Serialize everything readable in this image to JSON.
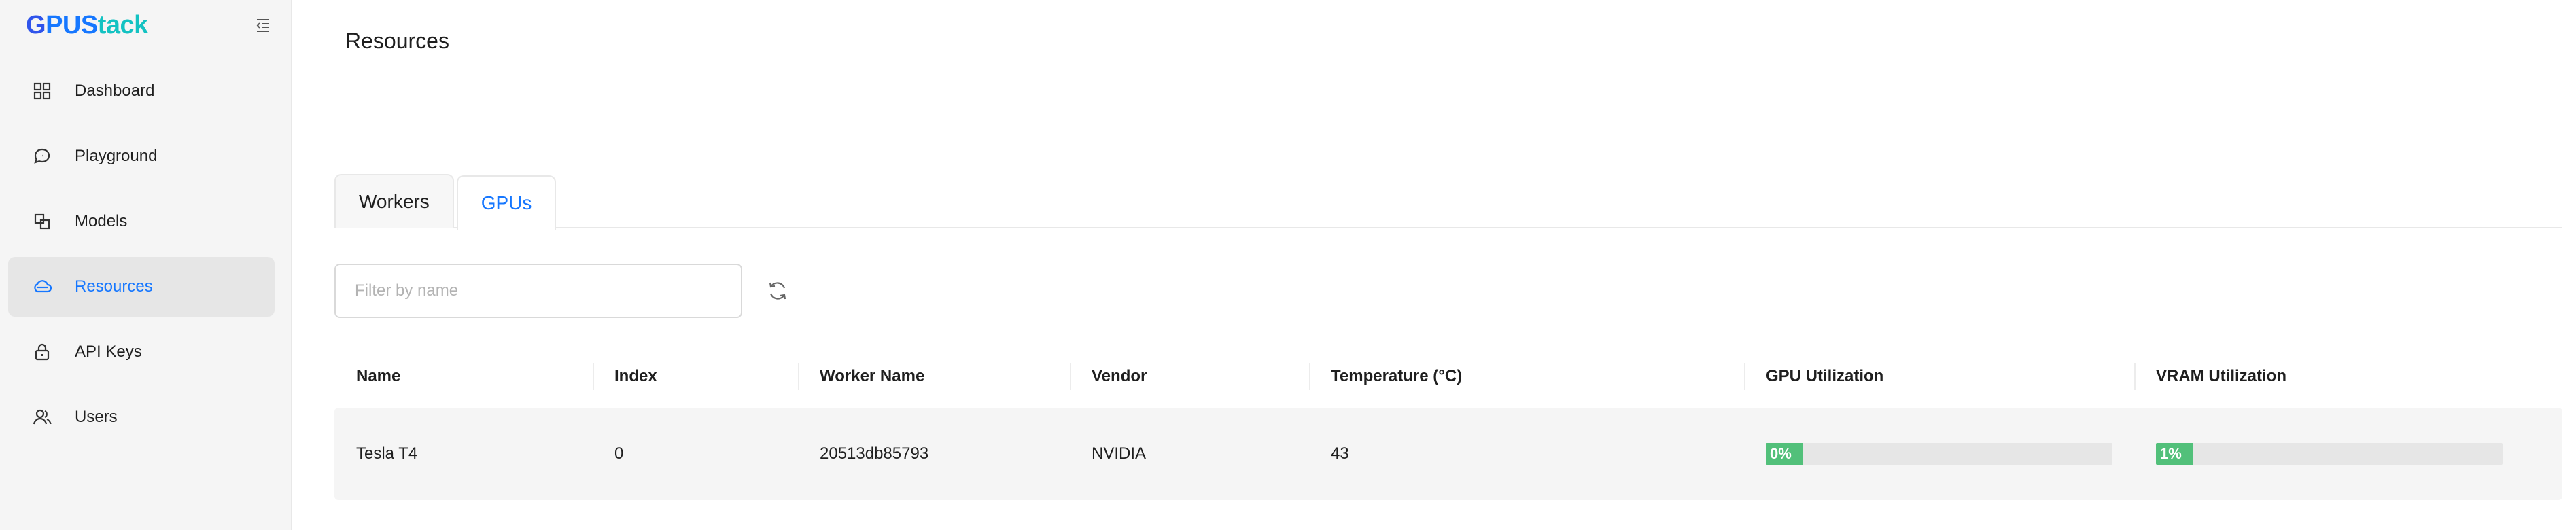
{
  "app": {
    "logo_g": "G",
    "logo_pus": "PUS",
    "logo_tack": "tack"
  },
  "sidebar": {
    "items": [
      {
        "label": "Dashboard",
        "icon": "dashboard-icon"
      },
      {
        "label": "Playground",
        "icon": "chat-icon"
      },
      {
        "label": "Models",
        "icon": "models-icon"
      },
      {
        "label": "Resources",
        "icon": "cloud-icon",
        "active": true
      },
      {
        "label": "API Keys",
        "icon": "lock-icon"
      },
      {
        "label": "Users",
        "icon": "users-icon"
      }
    ]
  },
  "page": {
    "title": "Resources"
  },
  "tabs": [
    {
      "label": "Workers"
    },
    {
      "label": "GPUs",
      "active": true
    }
  ],
  "filter": {
    "placeholder": "Filter by name",
    "value": ""
  },
  "table": {
    "headers": [
      "Name",
      "Index",
      "Worker Name",
      "Vendor",
      "Temperature (°C)",
      "GPU Utilization",
      "VRAM Utilization"
    ],
    "rows": [
      {
        "name": "Tesla T4",
        "index": "0",
        "worker_name": "20513db85793",
        "vendor": "NVIDIA",
        "temperature": "43",
        "gpu_util": "0%",
        "gpu_util_value": 0,
        "vram_util": "1%",
        "vram_util_value": 1
      }
    ]
  },
  "colors": {
    "accent": "#1677ff",
    "progress": "#52c07a",
    "active_bg": "#e6e6e6"
  }
}
